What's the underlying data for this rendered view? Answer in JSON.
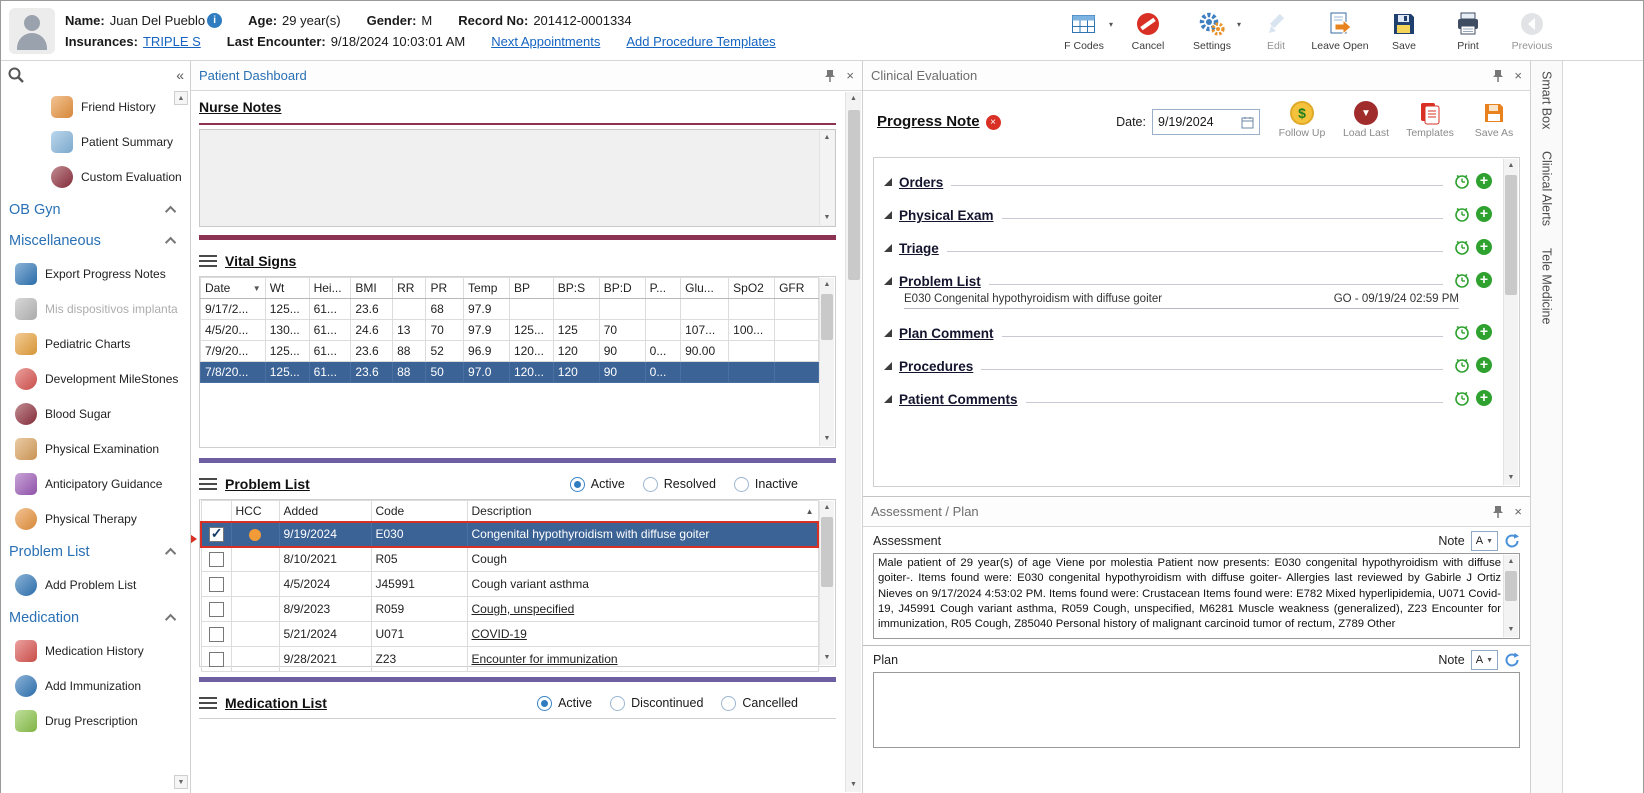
{
  "header": {
    "name_label": "Name:",
    "name_value": "Juan Del Pueblo",
    "age_label": "Age:",
    "age_value": "29 year(s)",
    "gender_label": "Gender:",
    "gender_value": "M",
    "record_label": "Record No:",
    "record_value": "201412-0001334",
    "insurances_label": "Insurances:",
    "insurances_value": "TRIPLE S",
    "last_encounter_label": "Last Encounter:",
    "last_encounter_value": "9/18/2024 10:03:01 AM",
    "next_appointments_link": "Next Appointments",
    "add_procedure_templates_link": "Add Procedure Templates",
    "toolbar": [
      {
        "label": "F Codes"
      },
      {
        "label": "Cancel"
      },
      {
        "label": "Settings"
      },
      {
        "label": "Edit"
      },
      {
        "label": "Leave Open"
      },
      {
        "label": "Save"
      },
      {
        "label": "Print"
      },
      {
        "label": "Previous"
      }
    ]
  },
  "sidebar": {
    "items": [
      {
        "label": "Friend History"
      },
      {
        "label": "Patient Summary"
      },
      {
        "label": "Custom Evaluation"
      },
      {
        "label": "OB Gyn"
      },
      {
        "label": "Miscellaneous"
      },
      {
        "label": "Export Progress Notes"
      },
      {
        "label": "Mis dispositivos implanta"
      },
      {
        "label": "Pediatric Charts"
      },
      {
        "label": "Development MileStones"
      },
      {
        "label": "Blood Sugar"
      },
      {
        "label": "Physical Examination"
      },
      {
        "label": "Anticipatory Guidance"
      },
      {
        "label": "Physical Therapy"
      },
      {
        "label": "Problem List"
      },
      {
        "label": "Add Problem List"
      },
      {
        "label": "Medication"
      },
      {
        "label": "Medication History"
      },
      {
        "label": "Add Immunization"
      },
      {
        "label": "Drug Prescription"
      }
    ]
  },
  "dashboard": {
    "title": "Patient Dashboard",
    "nurse_notes_heading": "Nurse Notes",
    "vital_signs": {
      "heading": "Vital Signs",
      "columns": [
        "Date",
        "Wt",
        "Hei...",
        "BMI",
        "RR",
        "PR",
        "Temp",
        "BP",
        "BP:S",
        "BP:D",
        "P...",
        "Glu...",
        "SpO2",
        "GFR"
      ],
      "rows": [
        [
          "9/17/2...",
          "125...",
          "61...",
          "23.6",
          "",
          "68",
          "97.9",
          "",
          "",
          "",
          "",
          "",
          "",
          ""
        ],
        [
          "4/5/20...",
          "130...",
          "61...",
          "24.6",
          "13",
          "70",
          "97.9",
          "125...",
          "125",
          "70",
          "",
          "107...",
          "100...",
          ""
        ],
        [
          "7/9/20...",
          "125...",
          "61...",
          "23.6",
          "88",
          "52",
          "96.9",
          "120...",
          "120",
          "90",
          "0...",
          "90.00",
          "",
          ""
        ],
        [
          "7/8/20...",
          "125...",
          "61...",
          "23.6",
          "88",
          "50",
          "97.0",
          "120...",
          "120",
          "90",
          "0...",
          "",
          "",
          ""
        ]
      ]
    },
    "problem_list": {
      "heading": "Problem List",
      "filter_active": "Active",
      "filter_resolved": "Resolved",
      "filter_inactive": "Inactive",
      "col_hcc": "HCC",
      "col_added": "Added",
      "col_code": "Code",
      "col_description": "Description",
      "rows": [
        {
          "added": "9/19/2024",
          "code": "E030",
          "description": "Congenital hypothyroidism with diffuse goiter"
        },
        {
          "added": "8/10/2021",
          "code": "R05",
          "description": "Cough"
        },
        {
          "added": "4/5/2024",
          "code": "J45991",
          "description": "Cough variant asthma"
        },
        {
          "added": "8/9/2023",
          "code": "R059",
          "description": "Cough, unspecified"
        },
        {
          "added": "5/21/2024",
          "code": "U071",
          "description": "COVID-19"
        },
        {
          "added": "9/28/2021",
          "code": "Z23",
          "description": "Encounter for immunization"
        }
      ]
    },
    "medication_list": {
      "heading": "Medication List",
      "filter_active": "Active",
      "filter_discontinued": "Discontinued",
      "filter_cancelled": "Cancelled"
    }
  },
  "clinical_eval": {
    "title": "Clinical Evaluation",
    "note_heading": "Progress Note",
    "date_label": "Date:",
    "date_value": "9/19/2024",
    "action_follow_up": "Follow Up",
    "action_load_last": "Load Last",
    "action_templates": "Templates",
    "action_save_as": "Save As",
    "sections": [
      {
        "label": "Orders"
      },
      {
        "label": "Physical Exam"
      },
      {
        "label": "Triage"
      },
      {
        "label": "Problem List"
      },
      {
        "label": "Plan Comment"
      },
      {
        "label": "Procedures"
      },
      {
        "label": "Patient Comments"
      }
    ],
    "problem_item_text": "E030 Congenital hypothyroidism with diffuse goiter",
    "problem_item_meta": "GO - 09/19/24 02:59 PM"
  },
  "assessment_plan": {
    "title": "Assessment / Plan",
    "assessment_label": "Assessment",
    "plan_label": "Plan",
    "assessment_note_label": "Note",
    "plan_note_label": "Note",
    "note_button": "A",
    "assessment_text": "Male patient of 29 year(s) of age Viene por molestia Patient now presents: E030 congenital hypothyroidism with diffuse goiter-. Items found were:  E030 congenital hypothyroidism with diffuse goiter-   Allergies last reviewed by Gabirle J Ortiz Nieves on 9/17/2024 4:53:02 PM.   Items found were:  Crustacean  Items found were:  E782 Mixed hyperlipidemia, U071 Covid-19, J45991 Cough variant asthma, R059 Cough, unspecified, M6281 Muscle weakness (generalized), Z23 Encounter for immunization, R05 Cough, Z85040 Personal history of malignant carcinoid tumor of rectum, Z789 Other",
    "plan_text": ""
  },
  "edge_tabs": [
    {
      "label": "Smart Box"
    },
    {
      "label": "Clinical Alerts"
    },
    {
      "label": "Tele Medicine"
    }
  ]
}
